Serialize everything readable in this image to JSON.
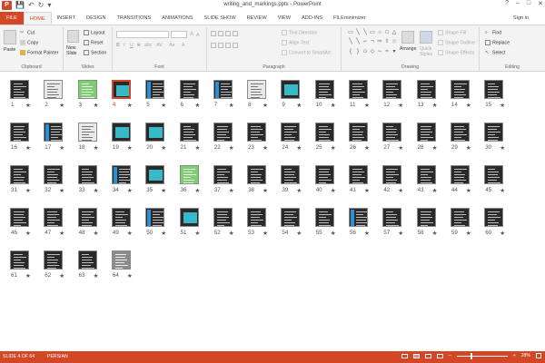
{
  "app": {
    "logo_letter": "P",
    "window_title": "writing_and_markings.pptx - PowerPoint",
    "accent_color": "#d24726",
    "window_controls": [
      "?",
      "–",
      "□",
      "✕"
    ]
  },
  "quick_access": {
    "save": "💾",
    "undo": "↶",
    "redo": "↻",
    "customize": "▾"
  },
  "tabs": [
    "FILE",
    "HOME",
    "INSERT",
    "DESIGN",
    "TRANSITIONS",
    "ANIMATIONS",
    "SLIDE SHOW",
    "REVIEW",
    "VIEW",
    "ADD-INS",
    "FILEminimizer"
  ],
  "active_tab": "HOME",
  "sign_in": "Sign in",
  "ribbon": {
    "clipboard": {
      "label": "Clipboard",
      "paste": "Paste",
      "cut": "Cut",
      "copy": "Copy",
      "format_painter": "Format Painter"
    },
    "slides": {
      "label": "Slides",
      "new_slide": "New Slide",
      "layout": "Layout",
      "reset": "Reset",
      "section": "Section"
    },
    "font": {
      "label": "Font",
      "bold": "B",
      "italic": "I",
      "underline": "U",
      "strike": "S",
      "shadow": "abc",
      "spacing": "AV",
      "case": "Aa",
      "grow": "A",
      "shrink": "A",
      "clear": "A"
    },
    "paragraph": {
      "label": "Paragraph",
      "text_direction": "Text Direction",
      "align_text": "Align Text",
      "smartart": "Convert to SmartArt"
    },
    "drawing": {
      "label": "Drawing",
      "arrange": "Arrange",
      "quick_styles": "Quick Styles",
      "shape_fill": "Shape Fill",
      "shape_outline": "Shape Outline",
      "shape_effects": "Shape Effects"
    },
    "editing": {
      "label": "Editing",
      "find": "Find",
      "replace": "Replace",
      "select": "Select"
    }
  },
  "slides": {
    "count": 64,
    "selected": 4,
    "star": "★",
    "styles": {
      "2": "light",
      "3": "green",
      "4": "cyan",
      "5": "bluebar",
      "7": "bluebar",
      "8": "light",
      "9": "cyan",
      "17": "bluebar",
      "18": "light",
      "19": "cyan",
      "20": "cyan",
      "34": "bluebar",
      "35": "cyan",
      "36": "green",
      "50": "bluebar",
      "51": "cyan",
      "56": "bluebar",
      "64": "photo"
    }
  },
  "status": {
    "slide_info": "SLIDE 4 OF 64",
    "language": "PERSIAN",
    "zoom_minus": "–",
    "zoom_plus": "+",
    "zoom_value": "28%",
    "zoom_level": 0.28
  }
}
